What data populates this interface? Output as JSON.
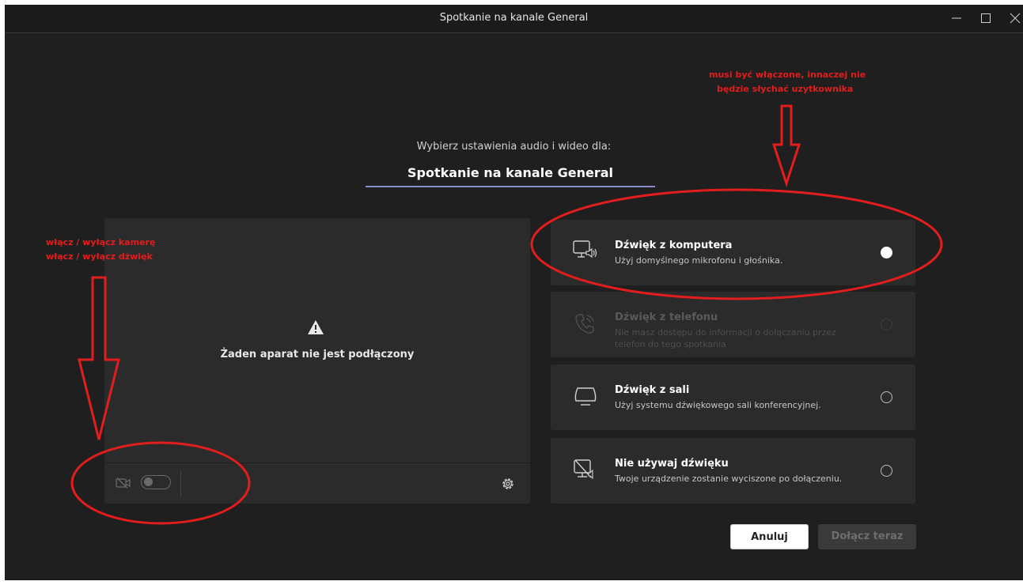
{
  "window": {
    "title": "Spotkanie na kanale General",
    "controls": [
      "minimize-icon",
      "maximize-icon",
      "close-icon"
    ]
  },
  "prompt": "Wybierz ustawienia audio i wideo dla:",
  "meeting_title": "Spotkanie na kanale General",
  "preview": {
    "no_camera": "Żaden aparat nie jest podłączony",
    "camera_toggle": "off"
  },
  "audio_options": [
    {
      "title": "Dźwięk z komputera",
      "desc": "Użyj domyślnego mikrofonu i głośnika.",
      "selected": true,
      "disabled": false,
      "icon": "computer-audio-icon"
    },
    {
      "title": "Dźwięk z telefonu",
      "desc": "Nie masz dostępu do informacji o dołączaniu przez telefon do tego spotkania",
      "selected": false,
      "disabled": true,
      "icon": "phone-icon"
    },
    {
      "title": "Dźwięk z sali",
      "desc": "Użyj systemu dźwiękowego sali konferencyjnej.",
      "selected": false,
      "disabled": false,
      "icon": "room-audio-icon"
    },
    {
      "title": "Nie używaj dźwięku",
      "desc": "Twoje urządzenie zostanie wyciszone po dołączeniu.",
      "selected": false,
      "disabled": false,
      "icon": "no-audio-icon"
    }
  ],
  "buttons": {
    "cancel": "Anuluj",
    "join": "Dołącz teraz"
  },
  "annotations": {
    "right_line1": "musi być włączone, innaczej nie",
    "right_line2": "będzie słychać uzytkownika",
    "left_line1": "włącz / wyłącz kamerę",
    "left_line2": "włącz / wyłącz dźwięk"
  },
  "colors": {
    "accent": "#8b8cc7",
    "annotation": "#e21d1d",
    "background": "#1f1f1f",
    "panel": "#2b2b2b"
  }
}
